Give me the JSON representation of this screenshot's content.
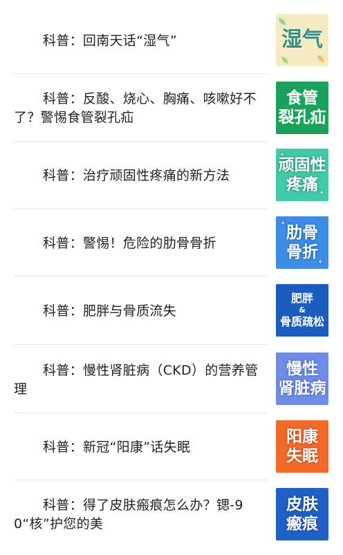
{
  "articles": [
    {
      "title": "科普：回南天话“湿气”",
      "thumb": {
        "lines": [
          "湿气"
        ],
        "theme": "humid",
        "bg": "#f4ecc0"
      }
    },
    {
      "title": "科普：反酸、烧心、胸痛、咳嗽好不了？警惕食管裂孔疝",
      "thumb": {
        "lines": [
          "食管",
          "裂孔疝"
        ],
        "theme": "green",
        "bg": "#1aa25a"
      }
    },
    {
      "title": "科普：治疗顽固性疼痛的新方法",
      "thumb": {
        "lines": [
          "顽固性",
          "疼痛"
        ],
        "theme": "teal",
        "bg": "#42c9a7"
      }
    },
    {
      "title": "科普：警惕！危险的肋骨骨折",
      "thumb": {
        "lines": [
          "肋骨",
          "骨折"
        ],
        "theme": "blue",
        "bg": "#3c8de6"
      }
    },
    {
      "title": "科普：肥胖与骨质流失",
      "thumb": {
        "lines": [
          "肥胖",
          "&",
          "骨质疏松"
        ],
        "theme": "navy",
        "bg": "#1b5cbf"
      }
    },
    {
      "title": "科普：慢性肾脏病（CKD）的营养管理",
      "thumb": {
        "lines": [
          "慢性",
          "肾脏病"
        ],
        "theme": "periwinkle",
        "bg": "#6d8ce6"
      }
    },
    {
      "title": "科普：新冠“阳康”话失眠",
      "thumb": {
        "lines": [
          "阳康",
          "失眠"
        ],
        "theme": "orange",
        "bg": "#f2692a"
      }
    },
    {
      "title": "科普：得了皮肤瘢痕怎么办？锶-90“核”护您的美",
      "thumb": {
        "lines": [
          "皮肤",
          "瘢痕"
        ],
        "theme": "royal",
        "bg": "#2160c6"
      }
    }
  ]
}
